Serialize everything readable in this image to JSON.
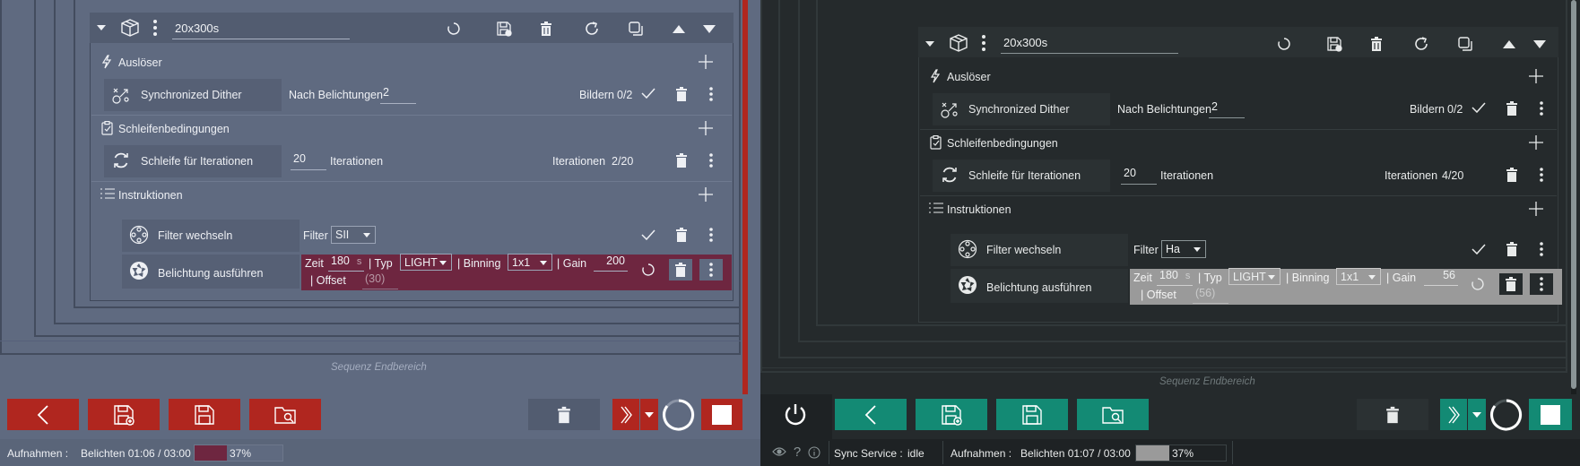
{
  "left": {
    "block": {
      "name": "20x300s"
    },
    "triggers": {
      "title": "Auslöser",
      "item": {
        "label": "Synchronized Dither",
        "after_label": "Nach Belichtungen",
        "after_value": "2",
        "status": "Bildern",
        "count": "0/2"
      }
    },
    "conditions": {
      "title": "Schleifenbedingungen",
      "item": {
        "label": "Schleife für Iterationen",
        "value": "20",
        "unit": "Iterationen",
        "status": "Iterationen",
        "count": "2/20"
      }
    },
    "instructions": {
      "title": "Instruktionen",
      "filter": {
        "label": "Filter wechseln",
        "field": "Filter",
        "value": "SII"
      },
      "exposure": {
        "label": "Belichtung ausführen",
        "time_label": "Zeit",
        "time": "180",
        "time_unit": "s",
        "type_label": "Typ",
        "type": "LIGHT",
        "binning_label": "Binning",
        "binning": "1x1",
        "gain_label": "Gain",
        "gain": "200",
        "offset_label": "Offset",
        "offset": "(30)"
      }
    },
    "footer_text": "Sequenz Endbereich",
    "status": {
      "capture_label": "Aufnahmen :",
      "exposure_text": "Belichten 01:06 / 03:00",
      "progress_text": "37%",
      "progress": 0.37
    }
  },
  "right": {
    "block": {
      "name": "20x300s"
    },
    "triggers": {
      "title": "Auslöser",
      "item": {
        "label": "Synchronized Dither",
        "after_label": "Nach Belichtungen",
        "after_value": "2",
        "status": "Bildern",
        "count": "0/2"
      }
    },
    "conditions": {
      "title": "Schleifenbedingungen",
      "item": {
        "label": "Schleife für Iterationen",
        "value": "20",
        "unit": "Iterationen",
        "status": "Iterationen",
        "count": "4/20"
      }
    },
    "instructions": {
      "title": "Instruktionen",
      "filter": {
        "label": "Filter wechseln",
        "field": "Filter",
        "value": "Ha"
      },
      "exposure": {
        "label": "Belichtung ausführen",
        "time_label": "Zeit",
        "time": "180",
        "time_unit": "s",
        "type_label": "Typ",
        "type": "LIGHT",
        "binning_label": "Binning",
        "binning": "1x1",
        "gain_label": "Gain",
        "gain": "56",
        "offset_label": "Offset",
        "offset": "(56)"
      }
    },
    "footer_text": "Sequenz Endbereich",
    "status": {
      "sync_label": "Sync Service :",
      "sync_value": "idle",
      "capture_label": "Aufnahmen :",
      "exposure_text": "Belichten 01:07 / 03:00",
      "progress_text": "37%",
      "progress": 0.37
    }
  },
  "colors": {
    "left_accent": "#b0261f",
    "left_running": "#6e2640",
    "right_accent": "#138a74",
    "right_running": "#9a9a9a"
  }
}
